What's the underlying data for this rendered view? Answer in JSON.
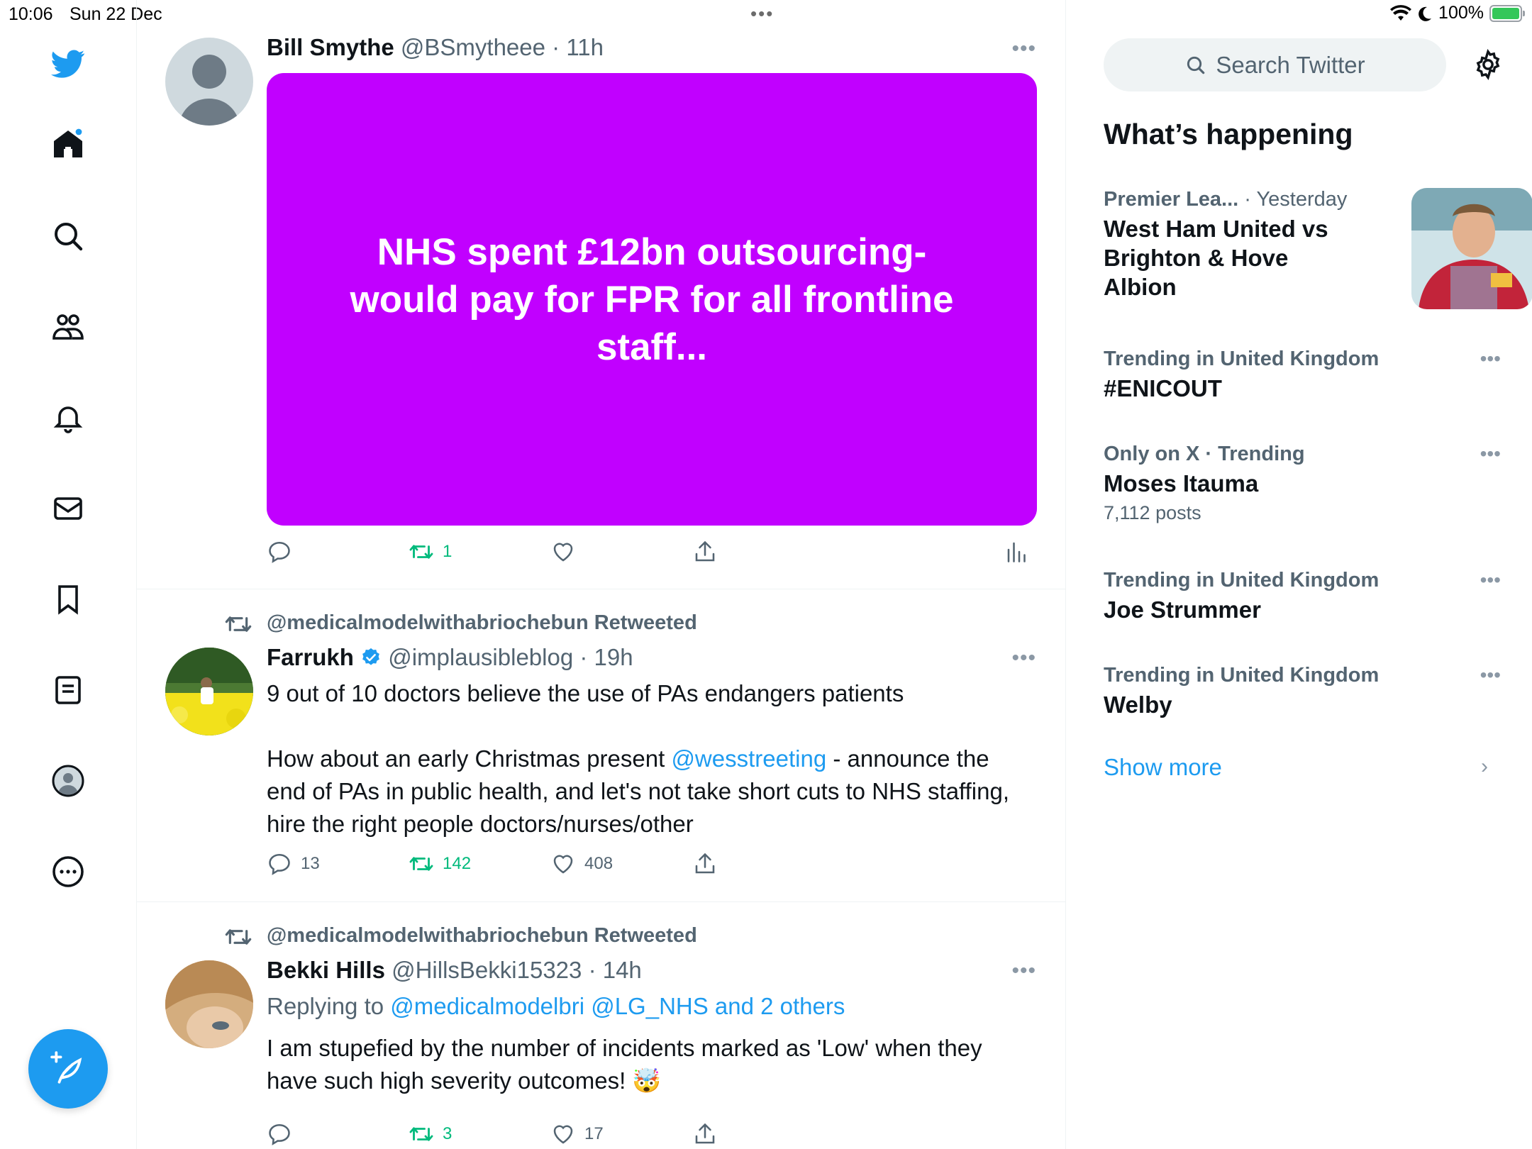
{
  "status_bar": {
    "time": "10:06",
    "date": "Sun 22 Dec",
    "battery": "100%"
  },
  "nav": {
    "icons": [
      "twitter-logo-icon",
      "home-icon",
      "search-icon",
      "communities-icon",
      "notifications-icon",
      "messages-icon",
      "bookmarks-icon",
      "lists-icon",
      "profile-icon",
      "more-icon"
    ],
    "compose_icon": "compose-icon"
  },
  "timeline": {
    "tweet1": {
      "name": "Bill Smythe",
      "handle": "@BSmytheee",
      "time": "· 11h",
      "media_text": "NHS spent £12bn outsourcing- would pay for FPR for all frontline staff...",
      "retweets": "1"
    },
    "tweet2": {
      "retweeted_by": "@medicalmodelwithabriochebun Retweeted",
      "name": "Farrukh",
      "handle": "@implausibleblog",
      "time": "· 19h",
      "line1": "9 out of 10 doctors believe the use of PAs endangers patients",
      "para2_before": "How about an early Christmas present ",
      "mention": "@wesstreeting",
      "para2_after": " - announce the end of PAs in public health, and let's not take short cuts to NHS staffing, hire the right people doctors/nurses/other",
      "replies": "13",
      "retweets": "142",
      "likes": "408"
    },
    "tweet3": {
      "retweeted_by": "@medicalmodelwithabriochebun Retweeted",
      "name": "Bekki Hills",
      "handle": "@HillsBekki15323",
      "time": "· 14h",
      "replying_prefix": "Replying to ",
      "replying_to": "@medicalmodelbri @LG_NHS and 2 others",
      "text": "I am stupefied by the number of incidents marked as 'Low' when they have such high severity outcomes! 🤯",
      "retweets": "3",
      "likes": "17"
    }
  },
  "sidebar": {
    "search_placeholder": "Search Twitter",
    "heading": "What’s happening",
    "trends": [
      {
        "context_bold": "Premier Lea...",
        "context_rest": " · Yesterday",
        "title": "West Ham United vs Brighton & Hove Albion"
      },
      {
        "context_bold": "Trending in United Kingdom",
        "context_rest": "",
        "title": "#ENICOUT"
      },
      {
        "context_bold": "Only on X · Trending",
        "context_rest": "",
        "title": "Moses Itauma",
        "posts": "7,112 posts"
      },
      {
        "context_bold": "Trending in United Kingdom",
        "context_rest": "",
        "title": "Joe Strummer"
      },
      {
        "context_bold": "Trending in United Kingdom",
        "context_rest": "",
        "title": "Welby"
      }
    ],
    "show_more": "Show more"
  },
  "colors": {
    "accent": "#1d9bf0",
    "retweet_green": "#00ba7c",
    "media_bg": "#c100ff",
    "muted": "#536471"
  }
}
